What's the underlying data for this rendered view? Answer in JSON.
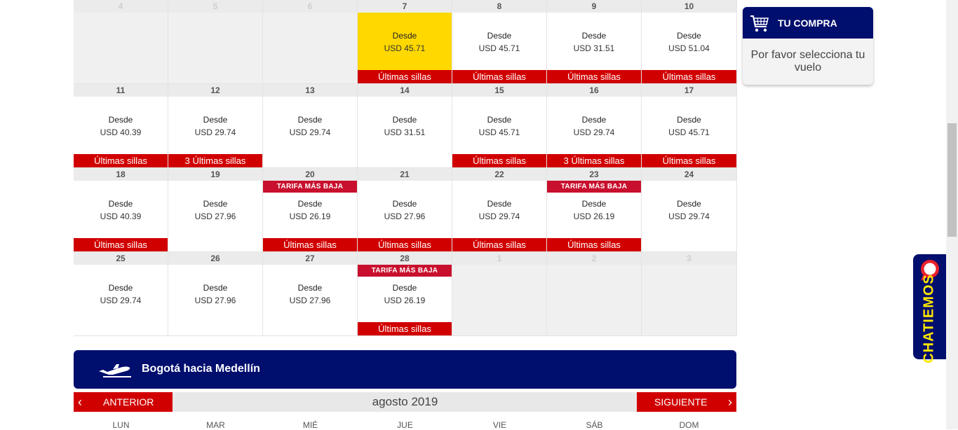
{
  "calendar": {
    "weeks": [
      [
        {
          "day": "4",
          "faded": true
        },
        {
          "day": "5",
          "faded": true
        },
        {
          "day": "6",
          "faded": true
        },
        {
          "day": "7",
          "from": "Desde",
          "price": "USD 45.71",
          "seats": "Últimas sillas",
          "selected": true
        },
        {
          "day": "8",
          "from": "Desde",
          "price": "USD 45.71",
          "seats": "Últimas sillas"
        },
        {
          "day": "9",
          "from": "Desde",
          "price": "USD 31.51",
          "seats": "Últimas sillas"
        },
        {
          "day": "10",
          "from": "Desde",
          "price": "USD 51.04",
          "seats": "Últimas sillas"
        }
      ],
      [
        {
          "day": "11",
          "from": "Desde",
          "price": "USD 40.39",
          "seats": "Últimas sillas"
        },
        {
          "day": "12",
          "from": "Desde",
          "price": "USD 29.74",
          "seats": "3 Últimas sillas"
        },
        {
          "day": "13",
          "from": "Desde",
          "price": "USD 29.74"
        },
        {
          "day": "14",
          "from": "Desde",
          "price": "USD 31.51"
        },
        {
          "day": "15",
          "from": "Desde",
          "price": "USD 45.71",
          "seats": "Últimas sillas"
        },
        {
          "day": "16",
          "from": "Desde",
          "price": "USD 29.74",
          "seats": "3 Últimas sillas"
        },
        {
          "day": "17",
          "from": "Desde",
          "price": "USD 45.71",
          "seats": "Últimas sillas"
        }
      ],
      [
        {
          "day": "18",
          "from": "Desde",
          "price": "USD 40.39",
          "seats": "Últimas sillas"
        },
        {
          "day": "19",
          "from": "Desde",
          "price": "USD 27.96"
        },
        {
          "day": "20",
          "from": "Desde",
          "price": "USD 26.19",
          "seats": "Últimas sillas",
          "lowfare": "TARIFA MÁS BAJA"
        },
        {
          "day": "21",
          "from": "Desde",
          "price": "USD 27.96",
          "seats": "Últimas sillas"
        },
        {
          "day": "22",
          "from": "Desde",
          "price": "USD 29.74",
          "seats": "Últimas sillas"
        },
        {
          "day": "23",
          "from": "Desde",
          "price": "USD 26.19",
          "seats": "Últimas sillas",
          "lowfare": "TARIFA MÁS BAJA"
        },
        {
          "day": "24",
          "from": "Desde",
          "price": "USD 29.74"
        }
      ],
      [
        {
          "day": "25",
          "from": "Desde",
          "price": "USD 29.74"
        },
        {
          "day": "26",
          "from": "Desde",
          "price": "USD 27.96"
        },
        {
          "day": "27",
          "from": "Desde",
          "price": "USD 27.96"
        },
        {
          "day": "28",
          "from": "Desde",
          "price": "USD 26.19",
          "seats": "Últimas sillas",
          "lowfare": "TARIFA MÁS BAJA"
        },
        {
          "day": "1",
          "faded": true
        },
        {
          "day": "2",
          "faded": true
        },
        {
          "day": "3",
          "faded": true
        }
      ]
    ]
  },
  "route": {
    "title": "Bogotá hacia Medellín",
    "icon": "airplane-takeoff-icon"
  },
  "month_nav": {
    "prev": "ANTERIOR",
    "next": "SIGUIENTE",
    "month": "agosto 2019"
  },
  "weekdays": [
    "LUN",
    "MAR",
    "MIÉ",
    "JUE",
    "VIE",
    "SÁB",
    "DOM"
  ],
  "cart": {
    "title": "TU COMPRA",
    "message": "Por favor selecciona tu vuelo",
    "icon": "shopping-cart-icon"
  },
  "chat": {
    "label": "CHATIEMOS",
    "icon": "chat-bubble-icon"
  },
  "colors": {
    "navy": "#000e6e",
    "red": "#d10000",
    "selected": "#ffd800",
    "chat_text": "#ffe600"
  }
}
